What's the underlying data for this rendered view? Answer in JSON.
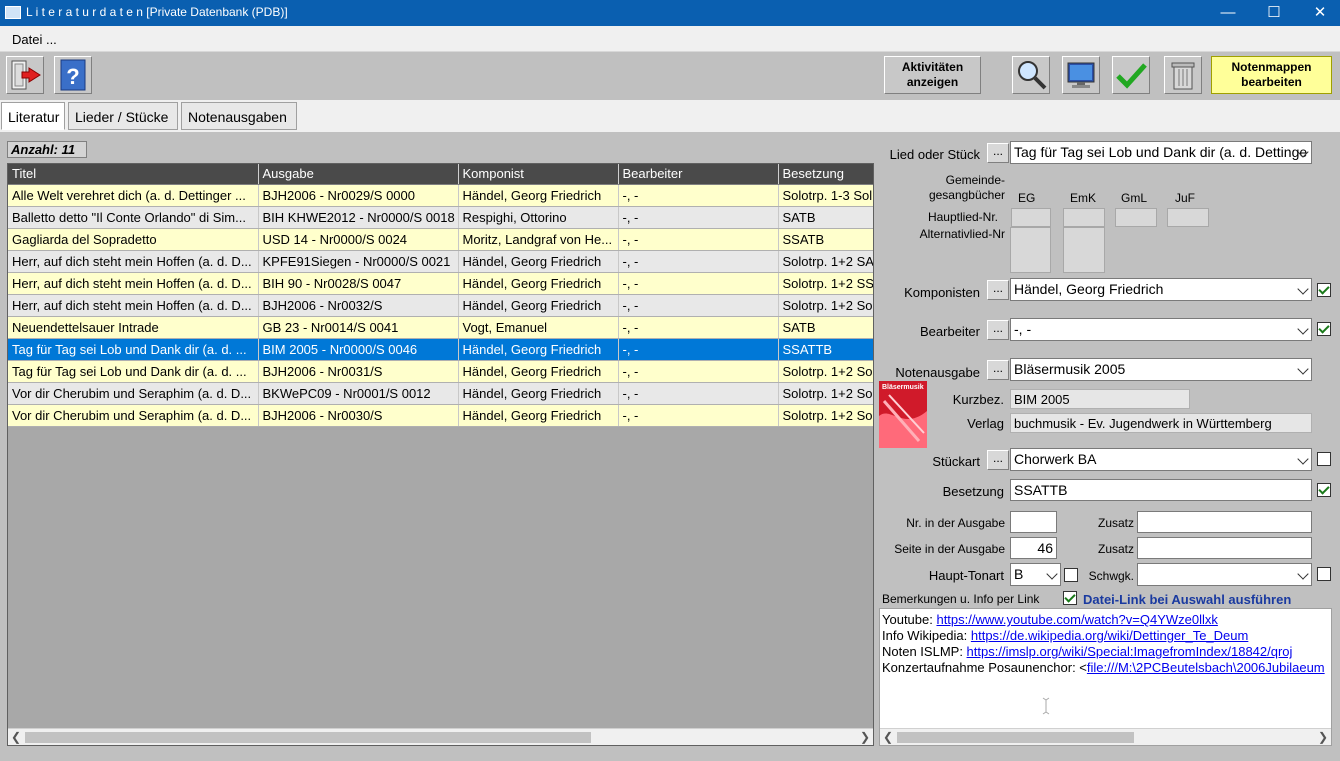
{
  "window": {
    "title": "L i t e r a t u r d a t e n   [Private Datenbank (PDB)]",
    "minimize": "—",
    "maximize": "☐",
    "close": "✕"
  },
  "menu": {
    "datei": "Datei ..."
  },
  "toolbar": {
    "aktivitaeten": "Aktivitäten anzeigen",
    "notenmappen": "Notenmappen bearbeiten",
    "icons": [
      "exit-icon",
      "help-icon",
      "search-icon",
      "monitor-icon",
      "checkmark-icon",
      "trash-icon"
    ]
  },
  "tabs": [
    "Literatur",
    "Lieder / Stücke",
    "Notenausgaben"
  ],
  "count_label": "Anzahl: 11",
  "grid": {
    "columns": [
      "Titel",
      "Ausgabe",
      "Komponist",
      "Bearbeiter",
      "Besetzung"
    ],
    "rows": [
      {
        "titel": "Alle Welt verehret dich (a. d. Dettinger ...",
        "ausgabe": "BJH2006 - Nr0029/S 0000",
        "komponist": "Händel, Georg Friedrich",
        "bearbeiter": "-, -",
        "besetzung": "Solotrp. 1-3  Sol",
        "style": "y"
      },
      {
        "titel": "Balletto detto \"Il Conte Orlando\" di Sim...",
        "ausgabe": "BIH KHWE2012 - Nr0000/S 0018",
        "komponist": "Respighi, Ottorino",
        "bearbeiter": "-, -",
        "besetzung": "SATB",
        "style": "g"
      },
      {
        "titel": "Gagliarda del Sopradetto",
        "ausgabe": "USD 14 - Nr0000/S 0024",
        "komponist": "Moritz, Landgraf von He...",
        "bearbeiter": "-, -",
        "besetzung": "SSATB",
        "style": "y"
      },
      {
        "titel": "Herr, auf dich steht mein Hoffen (a. d. D...",
        "ausgabe": "KPFE91Siegen - Nr0000/S 0021",
        "komponist": "Händel, Georg Friedrich",
        "bearbeiter": "-, -",
        "besetzung": "Solotrp. 1+2 SA",
        "style": "g"
      },
      {
        "titel": "Herr, auf dich steht mein Hoffen (a. d. D...",
        "ausgabe": "BIH 90 - Nr0028/S 0047",
        "komponist": "Händel, Georg Friedrich",
        "bearbeiter": "-, -",
        "besetzung": "Solotrp. 1+2 SS",
        "style": "y"
      },
      {
        "titel": "Herr, auf dich steht mein Hoffen (a. d. D...",
        "ausgabe": "BJH2006 - Nr0032/S",
        "komponist": "Händel, Georg Friedrich",
        "bearbeiter": "-, -",
        "besetzung": "Solotrp. 1+2  So",
        "style": "g"
      },
      {
        "titel": "Neuendettelsauer Intrade",
        "ausgabe": "GB 23 - Nr0014/S 0041",
        "komponist": "Vogt, Emanuel",
        "bearbeiter": "-, -",
        "besetzung": "SATB",
        "style": "y"
      },
      {
        "titel": "Tag für Tag sei Lob und Dank dir (a. d. ...",
        "ausgabe": "BIM 2005 - Nr0000/S 0046",
        "komponist": "Händel, Georg Friedrich",
        "bearbeiter": "-, -",
        "besetzung": "SSATTB",
        "style": "s"
      },
      {
        "titel": "Tag für Tag sei Lob und Dank dir (a. d. ...",
        "ausgabe": "BJH2006 - Nr0031/S",
        "komponist": "Händel, Georg Friedrich",
        "bearbeiter": "-, -",
        "besetzung": "Solotrp. 1+2  So",
        "style": "y"
      },
      {
        "titel": "Vor dir Cherubim und Seraphim (a. d. D...",
        "ausgabe": "BKWePC09 - Nr0001/S 0012",
        "komponist": "Händel, Georg Friedrich",
        "bearbeiter": "-, -",
        "besetzung": "Solotrp. 1+2 Sol",
        "style": "g"
      },
      {
        "titel": "Vor dir Cherubim und Seraphim (a. d. D...",
        "ausgabe": "BJH2006 - Nr0030/S",
        "komponist": "Händel, Georg Friedrich",
        "bearbeiter": "-, -",
        "besetzung": "Solotrp. 1+2  So",
        "style": "y"
      }
    ]
  },
  "detail": {
    "lied_label": "Lied oder Stück",
    "lied_value": "Tag für Tag sei Lob und Dank dir (a. d. Dettinge",
    "gemeinde_label": "Gemeinde-\ngesangbücher",
    "hauptlied_label": "Hauptlied-Nr.",
    "alternativlied_label": "Alternativlied-Nr",
    "book_eg": "EG",
    "book_emk": "EmK",
    "book_gml": "GmL",
    "book_juf": "JuF",
    "komponisten_label": "Komponisten",
    "komponisten_value": "Händel, Georg Friedrich",
    "bearbeiter_label": "Bearbeiter",
    "bearbeiter_value": "-, -",
    "notenausgabe_label": "Notenausgabe",
    "notenausgabe_value": "Bläsermusik 2005",
    "cover_text": "Bläsermusik",
    "kurzbez_label": "Kurzbez.",
    "kurzbez_value": "BIM 2005",
    "verlag_label": "Verlag",
    "verlag_value": "buchmusik - Ev. Jugendwerk in Württemberg",
    "stueckart_label": "Stückart",
    "stueckart_value": "Chorwerk BA",
    "besetzung_label": "Besetzung",
    "besetzung_value": "SSATTB",
    "nr_label": "Nr. in der Ausgabe",
    "nr_value": "",
    "zusatz_label": "Zusatz",
    "zusatz1_value": "",
    "seite_label": "Seite in der Ausgabe",
    "seite_value": "46",
    "zusatz2_value": "",
    "tonart_label": "Haupt-Tonart",
    "tonart_value": "B",
    "schwgk_label": "Schwgk.",
    "schwgk_value": "",
    "bemerkungen_label": "Bemerkungen u. Info per Link",
    "datei_link_label": "Datei-Link bei Auswahl ausführen",
    "dots": "..."
  },
  "memo": [
    {
      "prefix": "Youtube: ",
      "link": "https://www.youtube.com/watch?v=Q4YWze0llxk"
    },
    {
      "prefix": "Info Wikipedia: ",
      "link": "https://de.wikipedia.org/wiki/Dettinger_Te_Deum"
    },
    {
      "prefix": "Noten ISLMP: ",
      "link": "https://imslp.org/wiki/Special:ImagefromIndex/18842/qroj"
    },
    {
      "prefix": "Konzertaufnahme Posaunenchor: <",
      "link": "file:///M:\\2PCBeutelsbach\\2006Jubilaeum"
    }
  ],
  "colors": {
    "titlebar": "#0a5fb0",
    "selected": "#0078d7",
    "row_yellow": "#ffffcc",
    "row_gray": "#e8e8e8",
    "accent_button": "#ffff99"
  }
}
